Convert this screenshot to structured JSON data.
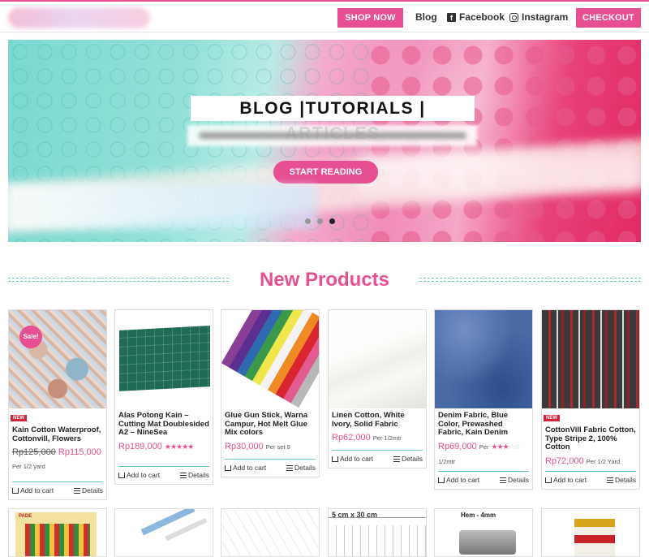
{
  "header": {
    "shop_now": "SHOP NOW",
    "blog": "Blog",
    "facebook": "Facebook",
    "instagram": "Instagram",
    "checkout": "CHECKOUT"
  },
  "hero": {
    "title": "BLOG |TUTORIALS | ARTICLES",
    "button": "START READING",
    "slides": 3,
    "active_slide": 3
  },
  "section_title": "New Products",
  "products": [
    {
      "name": "Kain Cotton Waterproof, Cottonvill, Flowers",
      "old_price": "Rp125,000",
      "price": "Rp115,000",
      "per": "Per 1/2 yard",
      "badge": "NEW",
      "sale": "Sale!",
      "add": "Add to cart",
      "details": "Details"
    },
    {
      "name": "Alas Potong Kain – Cutting Mat Doublesided A2 – NineSea",
      "price": "Rp189,000",
      "rating": 5,
      "add": "Add to cart",
      "details": "Details"
    },
    {
      "name": "Glue Gun Stick, Warna Campur, Hot Melt Glue Mix colors",
      "price": "Rp30,000",
      "per": "Per set 9",
      "add": "Add to cart",
      "details": "Details"
    },
    {
      "name": "Linen Cotton, White Ivory, Solid Fabric",
      "price": "Rp62,000",
      "per": "Per 1/2mtr",
      "add": "Add to cart",
      "details": "Details"
    },
    {
      "name": "Denim Fabric, Blue Color, Prewashed Fabric, Kain Denim",
      "price": "Rp69,000",
      "per": "Per",
      "per2": "1/2mtr",
      "rating": 3,
      "add": "Add to cart",
      "details": "Details"
    },
    {
      "name": "CottonVill Fabric Cotton, Type Stripe 2, 100% Cotton",
      "price": "Rp72,000",
      "per": "Per 1/2 Yard",
      "badge": "NEW",
      "add": "Add to cart",
      "details": "Details"
    }
  ],
  "row2_labels": [
    "PADE",
    "",
    "",
    "5 cm x 30 cm",
    "Hem - 4mm",
    ""
  ],
  "colors": {
    "accent": "#e84e92",
    "teal": "#6cc9c2"
  }
}
